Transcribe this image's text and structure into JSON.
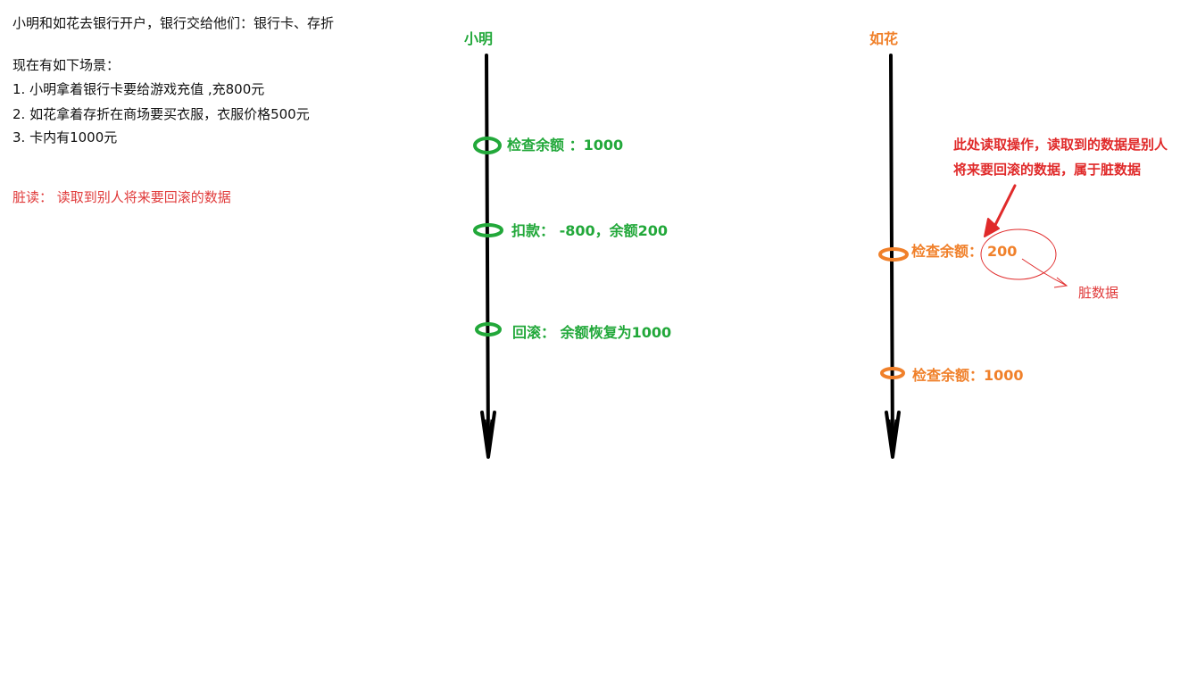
{
  "intro": {
    "line1": "小明和如花去银行开户，银行交给他们：银行卡、存折",
    "scenario_title": "现在有如下场景：",
    "items": [
      "1. 小明拿着银行卡要给游戏充值 ,充800元",
      "2. 如花拿着存折在商场要买衣服，衣服价格500元",
      "3. 卡内有1000元"
    ],
    "definition": "脏读： 读取到别人将来要回滚的数据"
  },
  "lanes": {
    "xiaoming": {
      "title": "小明",
      "color": "#22a83a",
      "steps": [
        "检查余额 ：1000",
        "扣款： -800，余额200",
        "回滚： 余额恢复为1000"
      ]
    },
    "ruhua": {
      "title": "如花",
      "color": "#f0802a",
      "steps": [
        "检查余额：",
        "200",
        "检查余额：1000"
      ]
    }
  },
  "annotation": {
    "note_line1": "此处读取操作，读取到的数据是别人",
    "note_line2": "将来要回滚的数据，属于脏数据",
    "dirty_label": "脏数据",
    "color": "#e02a2a"
  }
}
